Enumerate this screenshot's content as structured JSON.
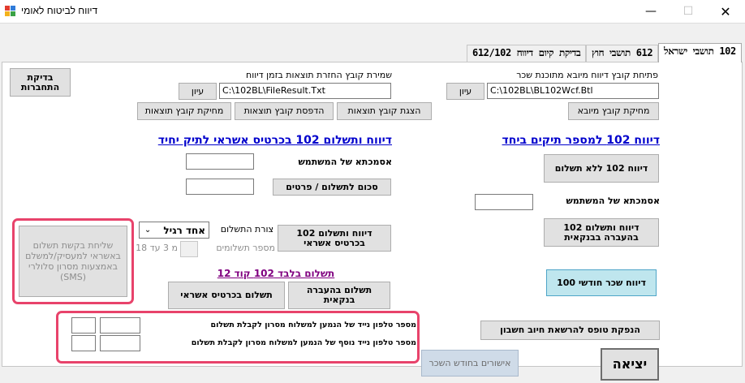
{
  "window": {
    "title": "דיווח לביטוח לאומי",
    "minimize_glyph": "—",
    "maximize_glyph": "☐",
    "close_glyph": "✕",
    "icon_colors": [
      "#e23b2e",
      "#2f7bd9",
      "#f3b21b",
      "#3aa245"
    ]
  },
  "tabs": [
    {
      "label": "102 תושבי ישראל",
      "active": true
    },
    {
      "label": "612 תושבי חוץ",
      "active": false
    },
    {
      "label": "בדיקת קיום דיווח 612/102",
      "active": false
    }
  ],
  "import_section": {
    "label": "פתיחת קובץ דיווח מיובא מתוכנת שכר",
    "file_path": "C:\\102BL\\BL102Wcf.Btl",
    "edit_button": "עיון",
    "delete_button": "מחיקת קובץ מיובא"
  },
  "results_section": {
    "label": "שמירת קובץ החזרת תוצאות בזמן דיווח",
    "file_path": "C:\\102BL\\FileResult.Txt",
    "edit_button": "עיון",
    "show_button": "הצגת קובץ תוצאות",
    "print_button": "הדפסת קובץ תוצאות",
    "delete_button": "מחיקת קובץ תוצאות"
  },
  "connection_check_button": "בדיקת התחברות",
  "left_panel": {
    "heading": "דיווח 102 למספר תיקים ביחד",
    "report_no_payment_button": "דיווח 102 ללא תשלום",
    "user_reference_label": "אסמכתא של המשתמש",
    "user_reference_value": "",
    "bank_transfer_button": "דיווח ותשלום 102 בהעברה בבנקאית",
    "monthly_salary_button": "דיווח שכר חודשי 100",
    "debit_form_button": "הנפקת טופס להרשאת חיוב חשבון"
  },
  "right_panel": {
    "heading": "דיווח ותשלום 102 בכרטיס אשראי לתיק יחיד",
    "user_reference_label": "אסמכתא של המשתמש",
    "user_reference_value": "",
    "payment_details_button": "סכום לתשלום / פרטים",
    "payment_details_value": "",
    "credit_report_button": "דיווח ותשלום 102 בכרטיס אשראי",
    "payment_form_label": "צורת התשלום",
    "payment_form_value": "אחד רגיל",
    "installments_label": "מספר תשלומים",
    "installments_value": "",
    "installments_range": "מ 3 עד 18",
    "sms_button": "שליחת בקשת תשלום באשראי למעסיק/למשלם באמצעות מסרון סלולרי (SMS)",
    "payment_only_heading": "תשלום בלבד 102 קוד 12",
    "pay_bank_transfer_button": "תשלום בהעברה בנקאית",
    "pay_credit_button": "תשלום בכרטיס אשראי",
    "phone_label_1": "מספר טלפון נייד של הנמען למשלוח מסרון לקבלת תשלום",
    "phone_label_2": "מספר טלפון נייד נוסף של הנמען למשלוח מסרון לקבלת תשלום",
    "phone_1_number": "",
    "phone_1_prefix": "",
    "phone_2_number": "",
    "phone_2_prefix": ""
  },
  "bottom": {
    "monthly_confirmations_button": "אישורים בחודש השכר",
    "exit_button": "יציאה"
  },
  "colors": {
    "heading_blue": "#0000cc",
    "heading_purple": "#800080",
    "highlight_pink": "#e8436b",
    "teal_button": "#bfe6ee"
  }
}
